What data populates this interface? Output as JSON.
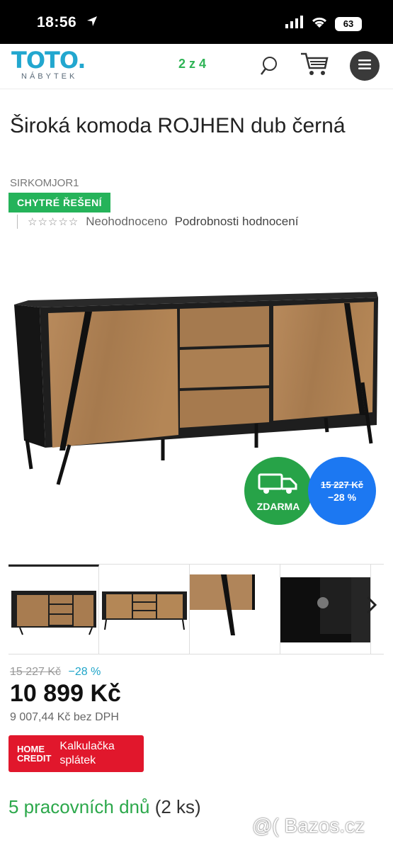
{
  "status_bar": {
    "time": "18:56",
    "battery": "63"
  },
  "header": {
    "logo_main": "TOTO.",
    "logo_sub": "NÁBYTEK",
    "page_counter": "2 z 4",
    "colors": {
      "brand": "#22a7cf",
      "menu_bg": "#3a3a3a"
    }
  },
  "product": {
    "title": "Široká komoda ROJHEN dub černá",
    "sku": "SIRKOMJOR1",
    "badge": "CHYTRÉ ŘEŠENÍ",
    "rating_label": "Neohodnoceno",
    "rating_link": "Podrobnosti hodnocení",
    "stars": "☆☆☆☆☆"
  },
  "promo": {
    "free_shipping": "ZDARMA",
    "old_price": "15 227 Kč",
    "discount": "−28 %"
  },
  "thumbnails": [
    "thumb-1",
    "thumb-2",
    "thumb-3",
    "thumb-4"
  ],
  "pricing": {
    "old_price": "15 227 Kč",
    "discount": "−28 %",
    "price": "10 899 Kč",
    "price_no_vat": "9 007,44 Kč bez DPH"
  },
  "home_credit": {
    "logo_line1": "HOME",
    "logo_line2": "CREDIT",
    "label_line1": "Kalkulačka",
    "label_line2": "splátek"
  },
  "delivery": {
    "days": "5 pracovních dnů",
    "qty": "(2 ks)"
  },
  "watermark": "@( Bazos.cz"
}
